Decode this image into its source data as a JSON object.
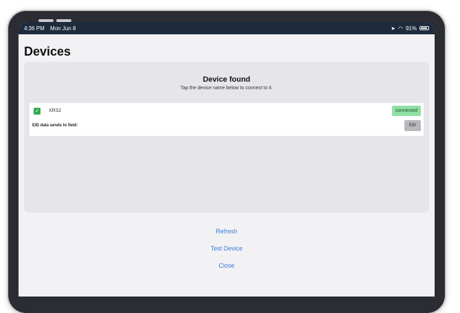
{
  "status_bar": {
    "time": "4:36 PM",
    "date": "Mon Jun 8",
    "battery": "91%"
  },
  "page": {
    "title": "Devices"
  },
  "panel": {
    "heading": "Device found",
    "subheading": "Tap the device name below to connect to it."
  },
  "device": {
    "name": "XRS2",
    "status": "connected",
    "eid_label": "EID data sends to field:",
    "eid_button": "EID",
    "checked": true,
    "status_color": "#8fe0a4"
  },
  "actions": {
    "refresh": "Refresh",
    "test_device": "Test Device",
    "close": "Close"
  },
  "colors": {
    "accent": "#3a7bd5",
    "status_bar": "#1d2b3d"
  }
}
